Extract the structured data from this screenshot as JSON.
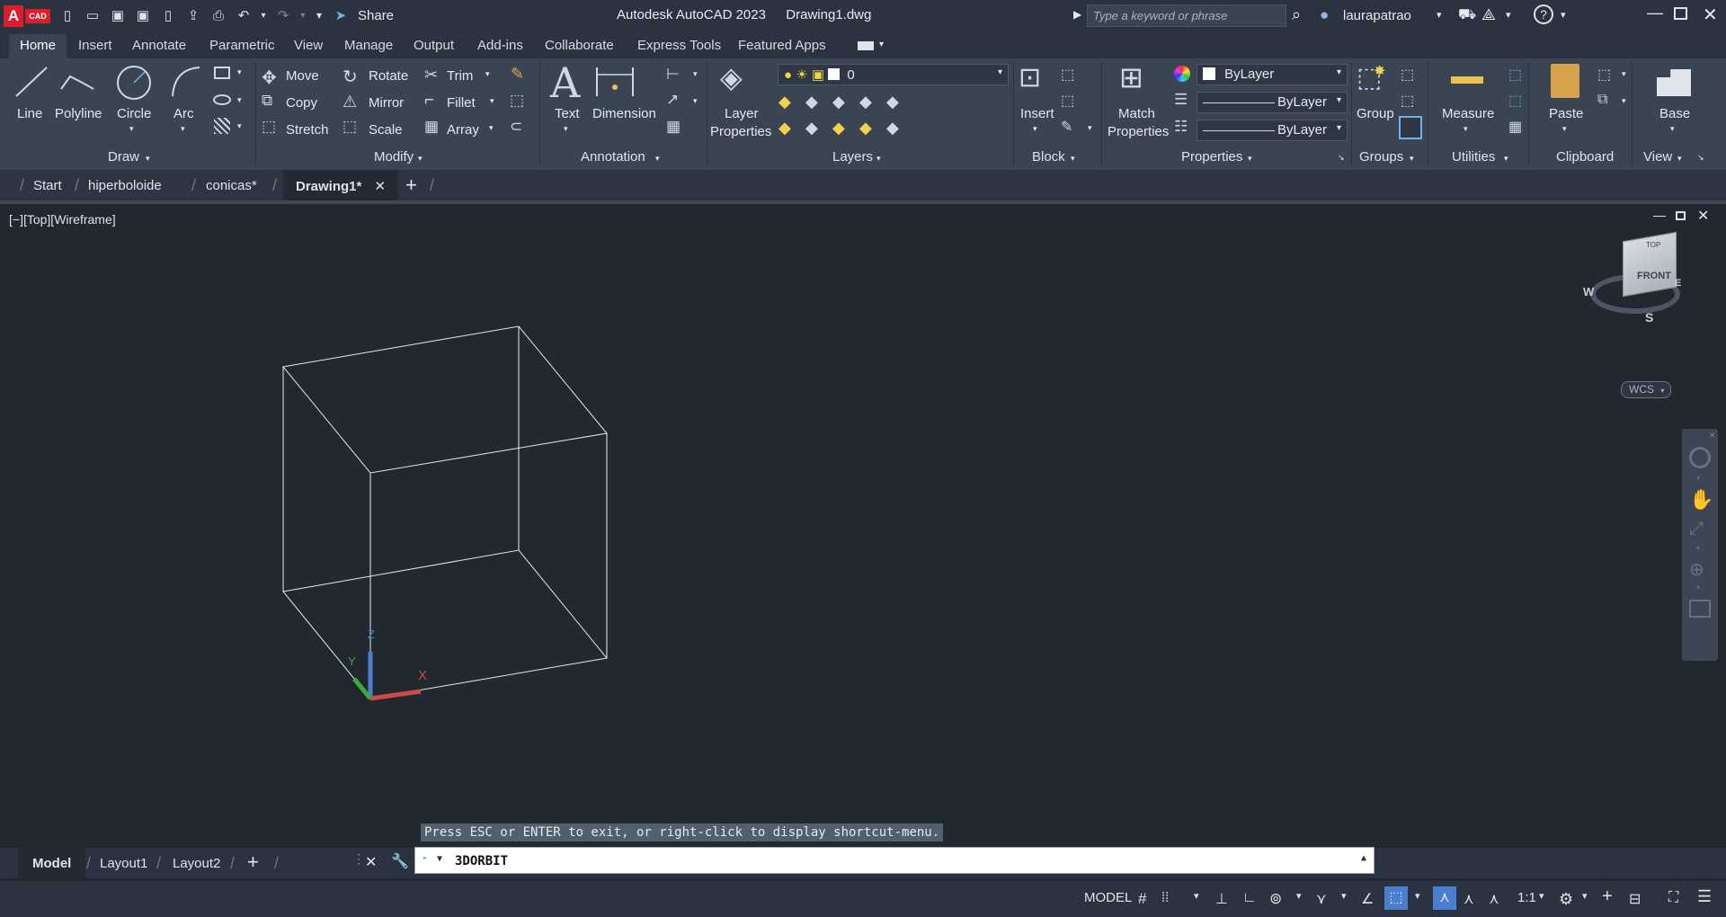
{
  "app": {
    "title": "Autodesk AutoCAD 2023",
    "file": "Drawing1.dwg",
    "logo_letter": "A",
    "logo_sub": "CAD",
    "share_label": "Share"
  },
  "search": {
    "placeholder": "Type a keyword or phrase"
  },
  "user": {
    "name": "laurapatrao"
  },
  "ribbon_tabs": [
    "Home",
    "Insert",
    "Annotate",
    "Parametric",
    "View",
    "Manage",
    "Output",
    "Add-ins",
    "Collaborate",
    "Express Tools",
    "Featured Apps"
  ],
  "draw": {
    "title": "Draw",
    "line": "Line",
    "polyline": "Polyline",
    "circle": "Circle",
    "arc": "Arc"
  },
  "modify": {
    "title": "Modify",
    "move": "Move",
    "rotate": "Rotate",
    "trim": "Trim",
    "copy": "Copy",
    "mirror": "Mirror",
    "fillet": "Fillet",
    "stretch": "Stretch",
    "scale": "Scale",
    "array": "Array"
  },
  "annotation": {
    "title": "Annotation",
    "text": "Text",
    "dimension": "Dimension"
  },
  "layers": {
    "title": "Layers",
    "layer_properties_1": "Layer",
    "layer_properties_2": "Properties",
    "current_layer": "0"
  },
  "block": {
    "title": "Block",
    "insert": "Insert"
  },
  "properties": {
    "title": "Properties",
    "match_1": "Match",
    "match_2": "Properties",
    "color": "ByLayer",
    "linetype": "ByLayer",
    "lineweight": "ByLayer"
  },
  "groups": {
    "title": "Groups",
    "group": "Group"
  },
  "utilities": {
    "title": "Utilities",
    "measure": "Measure"
  },
  "clipboard": {
    "title": "Clipboard",
    "paste": "Paste"
  },
  "view": {
    "title": "View",
    "base": "Base"
  },
  "file_tabs": {
    "start": "Start",
    "t1": "hiperboloide",
    "t2": "conicas*",
    "active": "Drawing1*"
  },
  "viewport": {
    "label": "[−][Top][Wireframe]"
  },
  "viewcube": {
    "top": "TOP",
    "front": "FRONT",
    "w": "W",
    "s": "S",
    "e": "E",
    "wcs": "WCS"
  },
  "ucs": {
    "x": "X",
    "y": "Y",
    "z": "Z"
  },
  "layout_tabs": {
    "model": "Model",
    "layout1": "Layout1",
    "layout2": "Layout2"
  },
  "command": {
    "text": "3DORBIT",
    "prompt": "Press ESC or ENTER to exit, or right-click to display shortcut-menu."
  },
  "status": {
    "model": "MODEL",
    "scale": "1:1"
  }
}
